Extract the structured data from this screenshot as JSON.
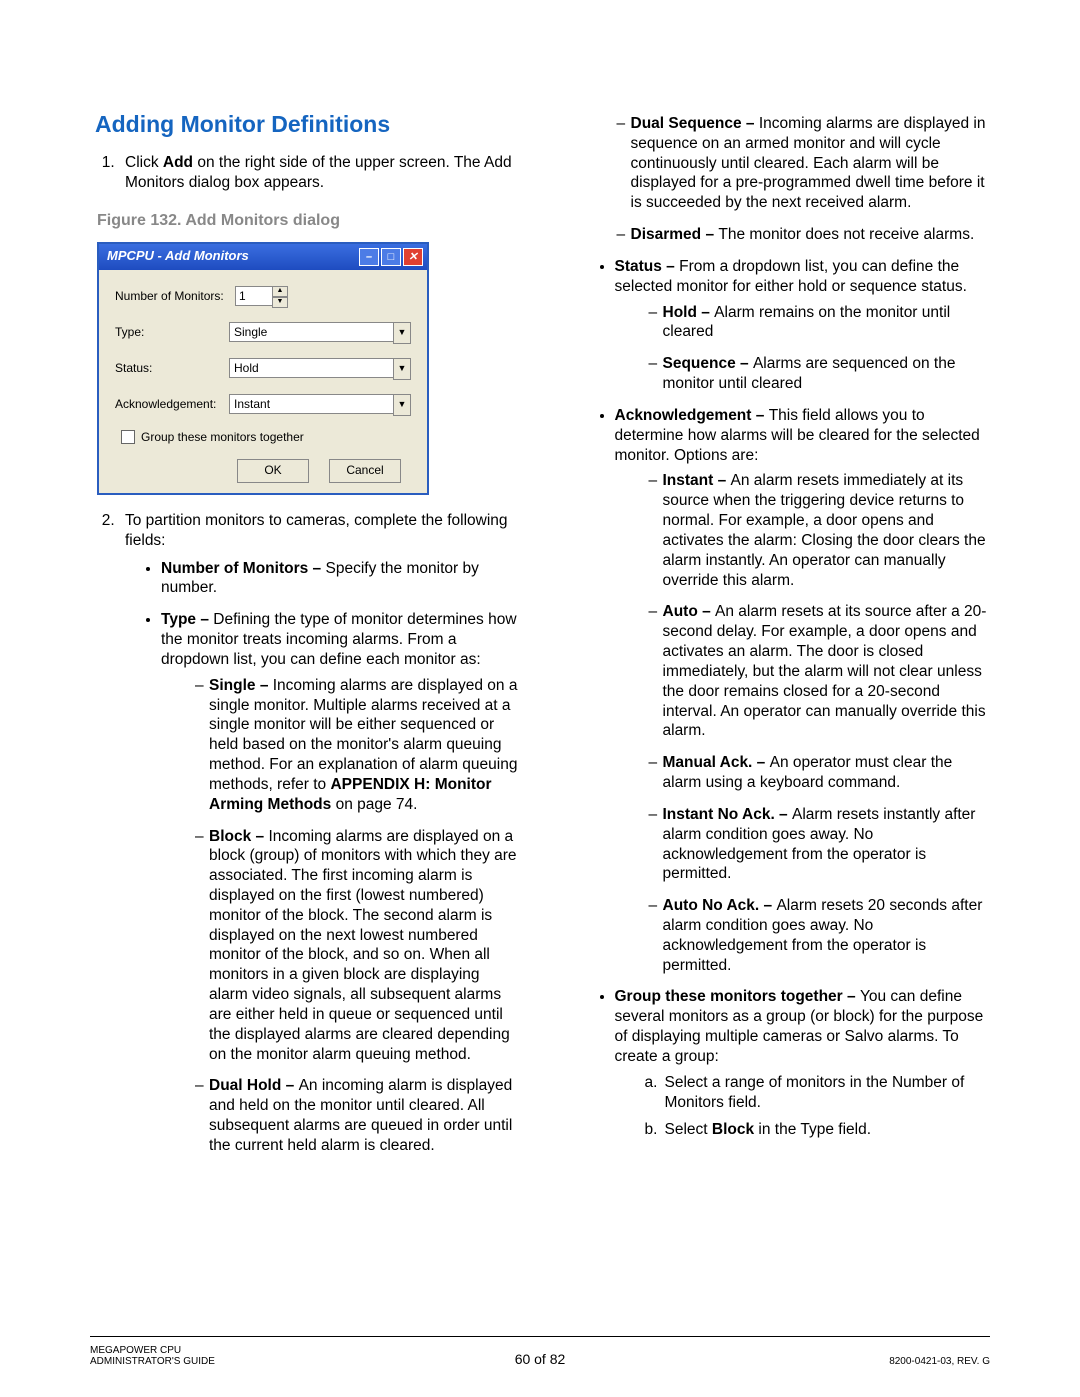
{
  "heading": "Adding Monitor Definitions",
  "step1": {
    "pre": "Click ",
    "bold": "Add",
    "post": " on the right side of the upper screen. The Add Monitors dialog box appears."
  },
  "figcaption": "Figure 132. Add Monitors dialog",
  "dialog": {
    "title": "MPCPU - Add Monitors",
    "fields": {
      "num_label": "Number of Monitors:",
      "num_value": "1",
      "type_label": "Type:",
      "type_value": "Single",
      "status_label": "Status:",
      "status_value": "Hold",
      "ack_label": "Acknowledgement:",
      "ack_value": "Instant"
    },
    "checkbox_label": "Group these monitors together",
    "ok": "OK",
    "cancel": "Cancel"
  },
  "step2_intro": "To partition monitors to cameras, complete the following fields:",
  "num_monitors": {
    "lead": "Number of Monitors – ",
    "rest": "Specify the monitor by number."
  },
  "type_field": {
    "lead": "Type – ",
    "rest": "Defining the type of monitor determines how the monitor treats incoming alarms. From a dropdown list, you can define each monitor as:"
  },
  "type_opts": {
    "single": {
      "lead": "Single – ",
      "rest": "Incoming alarms are displayed on a single monitor. Multiple alarms received at a single monitor will be either sequenced or held based on the monitor's alarm queuing method. For an explanation of alarm queuing methods, refer to ",
      "bold2": "APPENDIX H: Monitor Arming Methods",
      "tail": " on page 74."
    },
    "block": {
      "lead": "Block – ",
      "rest": "Incoming alarms are displayed on a block (group) of monitors with which they are associated. The first incoming alarm is displayed on the first (lowest numbered) monitor of the block. The second alarm is displayed on the next lowest numbered monitor of the block, and so on. When all monitors in a given block are displaying alarm video signals, all subsequent alarms are either held in queue or sequenced until the displayed alarms are cleared depending on the monitor alarm queuing method."
    },
    "dualhold": {
      "lead": "Dual Hold – ",
      "rest": "An incoming alarm is displayed and held on the monitor until cleared. All subsequent alarms are queued in order until the current held alarm is cleared."
    },
    "dualseq": {
      "lead": "Dual Sequence – ",
      "rest": "Incoming alarms are displayed in sequence on an armed monitor and will cycle continuously until cleared. Each alarm will be displayed for a pre-programmed dwell time before it is succeeded by the next received alarm."
    },
    "disarmed": {
      "lead": "Disarmed – ",
      "rest": "The monitor does not receive alarms."
    }
  },
  "status_field": {
    "lead": "Status – ",
    "rest": "From a dropdown list, you can define the selected monitor for either hold or sequence status."
  },
  "status_opts": {
    "hold": {
      "lead": "Hold – ",
      "rest": "Alarm remains on the monitor until cleared"
    },
    "seq": {
      "lead": "Sequence – ",
      "rest": "Alarms are sequenced on the monitor until cleared"
    }
  },
  "ack_field": {
    "lead": "Acknowledgement – ",
    "rest": "This field allows you to determine how alarms will be cleared for the selected monitor. Options are:"
  },
  "ack_opts": {
    "instant": {
      "lead": "Instant – ",
      "rest": "An alarm resets immediately at its source when the triggering device returns to normal. For example, a door opens and activates the alarm: Closing the door clears the alarm instantly. An operator can manually override this alarm."
    },
    "auto": {
      "lead": "Auto – ",
      "rest": "An alarm resets at its source after a 20-second delay. For example, a door opens and activates an alarm. The door is closed immediately, but the alarm will not clear unless the door remains closed for a 20-second interval. An operator can manually override this alarm."
    },
    "manual": {
      "lead": "Manual Ack. – ",
      "rest": "An operator must clear the alarm using a keyboard command."
    },
    "inoack": {
      "lead": "Instant No Ack. – ",
      "rest": "Alarm resets instantly after alarm condition goes away. No acknowledgement from the operator is permitted."
    },
    "anoack": {
      "lead": "Auto No Ack. – ",
      "rest": "Alarm resets 20 seconds after alarm condition goes away. No acknowledgement from the operator is permitted."
    }
  },
  "group_field": {
    "lead": "Group these monitors together – ",
    "rest": "You can define several monitors as a group (or block) for the purpose of displaying multiple cameras or Salvo alarms. To create a group:"
  },
  "group_steps": {
    "a": "Select a range of monitors in the Number of Monitors field.",
    "b_pre": "Select ",
    "b_bold": "Block",
    "b_post": " in the Type field."
  },
  "footer": {
    "left1": "MEGAPOWER CPU",
    "left2": "ADMINISTRATOR'S GUIDE",
    "center": "60 of 82",
    "right": "8200-0421-03, REV. G"
  }
}
